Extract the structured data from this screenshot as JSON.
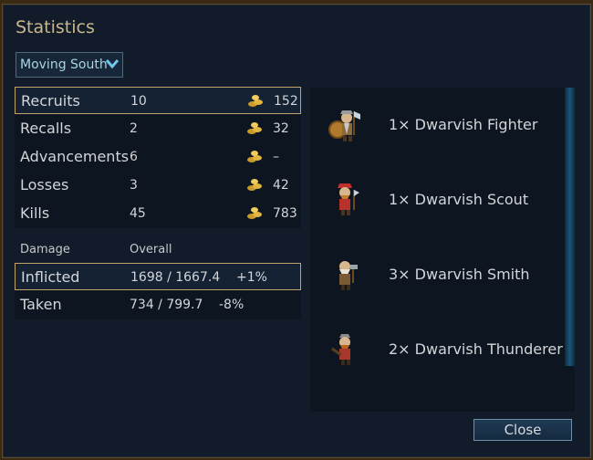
{
  "dialog": {
    "title": "Statistics"
  },
  "scope_select": {
    "value": "Moving South"
  },
  "stats": [
    {
      "label": "Recruits",
      "count": "10",
      "gold": "152",
      "selected": true
    },
    {
      "label": "Recalls",
      "count": "2",
      "gold": "32",
      "selected": false
    },
    {
      "label": "Advancements",
      "count": "6",
      "gold": "–",
      "selected": false
    },
    {
      "label": "Losses",
      "count": "3",
      "gold": "42",
      "selected": false
    },
    {
      "label": "Kills",
      "count": "45",
      "gold": "783",
      "selected": false
    }
  ],
  "damage": {
    "header_col1": "Damage",
    "header_col2": "Overall",
    "rows": [
      {
        "label": "Inflicted",
        "value": "1698 / 1667.4",
        "percent": "+1%"
      },
      {
        "label": "Taken",
        "value": "734 / 799.7",
        "percent": "-8%"
      }
    ]
  },
  "units": [
    {
      "text": "1× Dwarvish Fighter",
      "icon": "dwarvish-fighter-sprite"
    },
    {
      "text": "1× Dwarvish Scout",
      "icon": "dwarvish-scout-sprite"
    },
    {
      "text": "3× Dwarvish Smith",
      "icon": "dwarvish-smith-sprite"
    },
    {
      "text": "2× Dwarvish Thunderer",
      "icon": "dwarvish-thunderer-sprite"
    }
  ],
  "footer": {
    "close_label": "Close"
  },
  "colors": {
    "gold_accent": "#bfa56a",
    "title": "#c9b88d",
    "dropdown_text": "#a8d4e4"
  }
}
